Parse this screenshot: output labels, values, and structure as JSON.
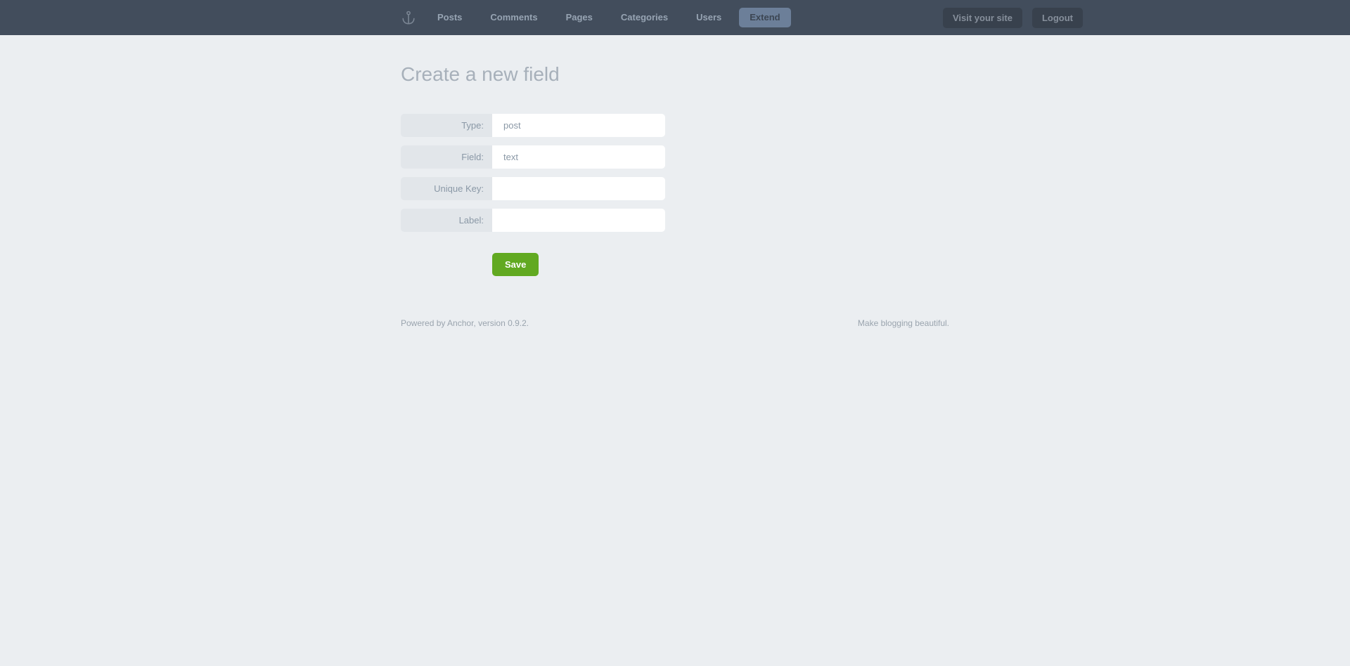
{
  "nav": {
    "items": [
      {
        "label": "Posts"
      },
      {
        "label": "Comments"
      },
      {
        "label": "Pages"
      },
      {
        "label": "Categories"
      },
      {
        "label": "Users"
      },
      {
        "label": "Extend"
      }
    ],
    "visit": "Visit your site",
    "logout": "Logout"
  },
  "page": {
    "title": "Create a new field"
  },
  "form": {
    "type": {
      "label": "Type:",
      "value": "post"
    },
    "field": {
      "label": "Field:",
      "value": "text"
    },
    "key": {
      "label": "Unique Key:",
      "value": ""
    },
    "lbl": {
      "label": "Label:",
      "value": ""
    },
    "save": "Save"
  },
  "footer": {
    "left": "Powered by Anchor, version 0.9.2.",
    "right": "Make blogging beautiful."
  }
}
